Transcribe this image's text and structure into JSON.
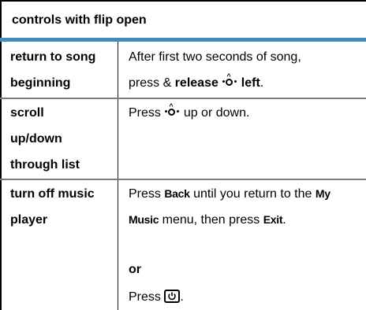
{
  "header": {
    "title": "controls with flip open"
  },
  "rows": [
    {
      "label_lines": [
        "return to song",
        "beginning"
      ],
      "desc_lines": [
        "After first two seconds of song,",
        "press &",
        "release",
        "left",
        "."
      ]
    },
    {
      "label_lines": [
        "scroll",
        "up/down",
        "through list"
      ],
      "desc_lines": [
        "Press",
        "up or down."
      ]
    },
    {
      "label_lines": [
        "turn off music",
        "player"
      ],
      "desc_lines": [
        "Press",
        "Back",
        "until you return to the",
        "My",
        "Music",
        "menu, then press",
        "Exit",
        "."
      ],
      "or_label": "or",
      "press_label": "Press",
      "period": "."
    }
  ],
  "icons": {
    "nav": "nav-key-icon",
    "power": "power-end-key-icon"
  }
}
